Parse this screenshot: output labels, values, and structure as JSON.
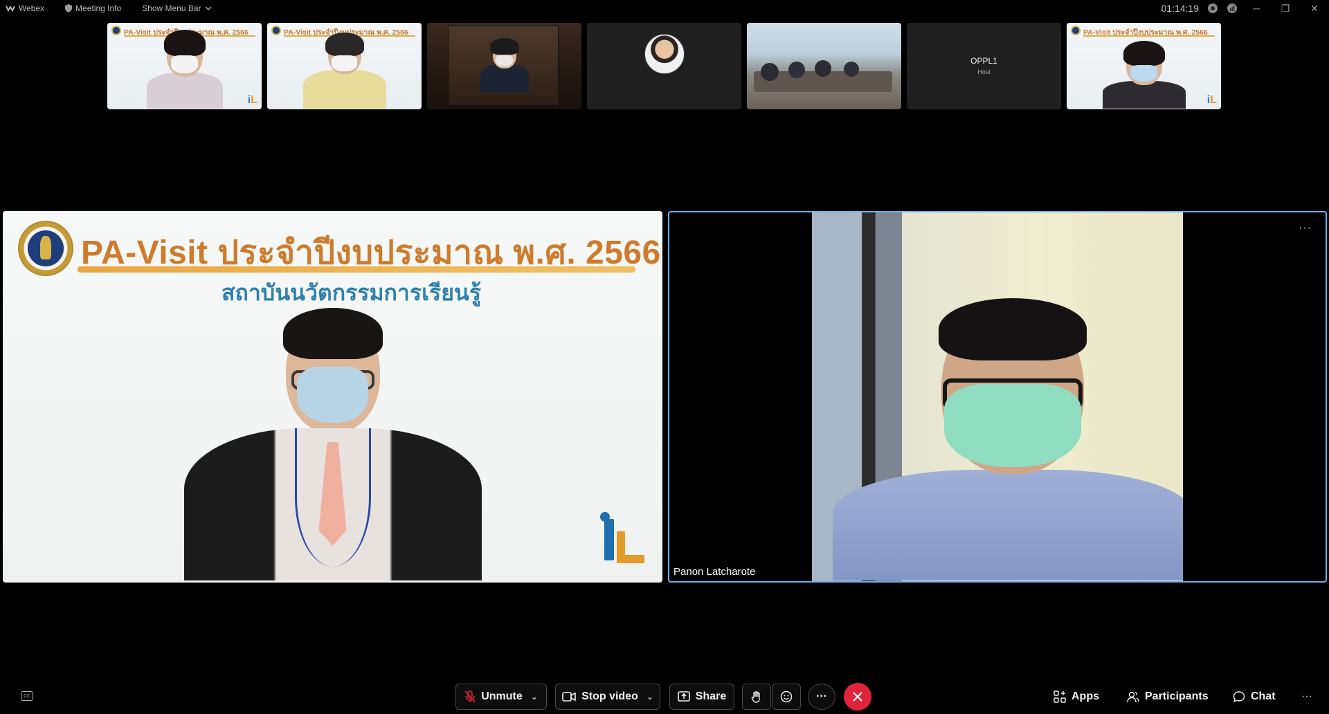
{
  "titlebar": {
    "app_name": "Webex",
    "meeting_info": "Meeting Info",
    "show_menu_bar": "Show Menu Bar",
    "timer": "01:14:19"
  },
  "filmstrip": {
    "tiles": [
      {
        "type": "slide",
        "title": "PA-Visit ประจำปีงบประมาณ พ.ศ. 2566"
      },
      {
        "type": "slide",
        "title": "PA-Visit ประจำปีงบประมาณ พ.ศ. 2566"
      },
      {
        "type": "video"
      },
      {
        "type": "avatar"
      },
      {
        "type": "video"
      },
      {
        "type": "host",
        "name": "OPPL1",
        "role": "Host"
      },
      {
        "type": "slide",
        "title": "PA-Visit ประจำปีงบประมาณ พ.ศ. 2566"
      }
    ]
  },
  "stage": {
    "left": {
      "slide_title": "PA-Visit ประจำปีงบประมาณ พ.ศ. 2566",
      "slide_subtitle": "สถาบันนวัตกรรมการเรียนรู้"
    },
    "right": {
      "participant_name": "Panon Latcharote",
      "more": "···"
    }
  },
  "controls": {
    "unmute": "Unmute",
    "stop_video": "Stop video",
    "share": "Share",
    "more": "···",
    "apps": "Apps",
    "participants": "Participants",
    "chat": "Chat",
    "overflow": "···"
  },
  "colors": {
    "end_call": "#e0243c",
    "active_border": "#6fb0ea",
    "slide_title": "#cf7b2c",
    "slide_subtitle": "#2d80ae"
  }
}
